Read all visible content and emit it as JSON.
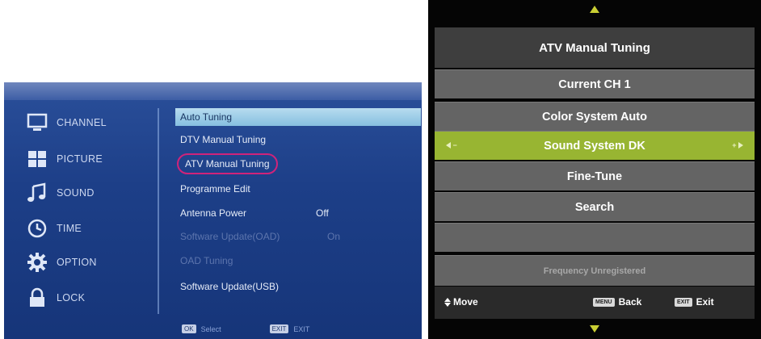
{
  "left_menu": {
    "categories": [
      {
        "label": "CHANNEL",
        "icon": "monitor-icon"
      },
      {
        "label": "PICTURE",
        "icon": "picture-grid-icon"
      },
      {
        "label": "SOUND",
        "icon": "music-note-icon"
      },
      {
        "label": "TIME",
        "icon": "clock-icon"
      },
      {
        "label": "OPTION",
        "icon": "gear-icon"
      },
      {
        "label": "LOCK",
        "icon": "lock-icon"
      }
    ],
    "items": [
      {
        "label": "Auto Tuning",
        "state": "highlighted"
      },
      {
        "label": "DTV Manual Tuning",
        "state": "normal"
      },
      {
        "label": "ATV Manual Tuning",
        "state": "circled"
      },
      {
        "label": "Programme Edit",
        "state": "normal"
      },
      {
        "label": "Antenna Power",
        "value": "Off",
        "state": "normal"
      },
      {
        "label": "Software Update(OAD)",
        "value": "On",
        "state": "disabled"
      },
      {
        "label": "OAD Tuning",
        "state": "disabled"
      },
      {
        "label": "Software Update(USB)",
        "state": "normal"
      }
    ],
    "footer": {
      "ok_key": "OK",
      "ok_label": "Select",
      "exit_key": "EXIT",
      "exit_label": "EXIT"
    }
  },
  "atv_menu": {
    "title": "ATV Manual Tuning",
    "rows": [
      {
        "label": "Current CH 1"
      },
      {
        "label": "Color System Auto"
      },
      {
        "label": "Sound System DK"
      },
      {
        "label": "Fine-Tune"
      },
      {
        "label": "Search"
      },
      {
        "label": ""
      }
    ],
    "status": "Frequency Unregistered",
    "footer": {
      "move_label": "Move",
      "menu_key": "MENU",
      "back_label": "Back",
      "exit_key": "EXIT",
      "exit_label": "Exit"
    }
  },
  "colors": {
    "left_background": "#1d3f88",
    "highlight": "#a7d1ea",
    "circle_annotation": "#d0237a",
    "selected_row": "#98b532",
    "row_background": "#646464",
    "arrow_accent": "#c9ce33"
  }
}
